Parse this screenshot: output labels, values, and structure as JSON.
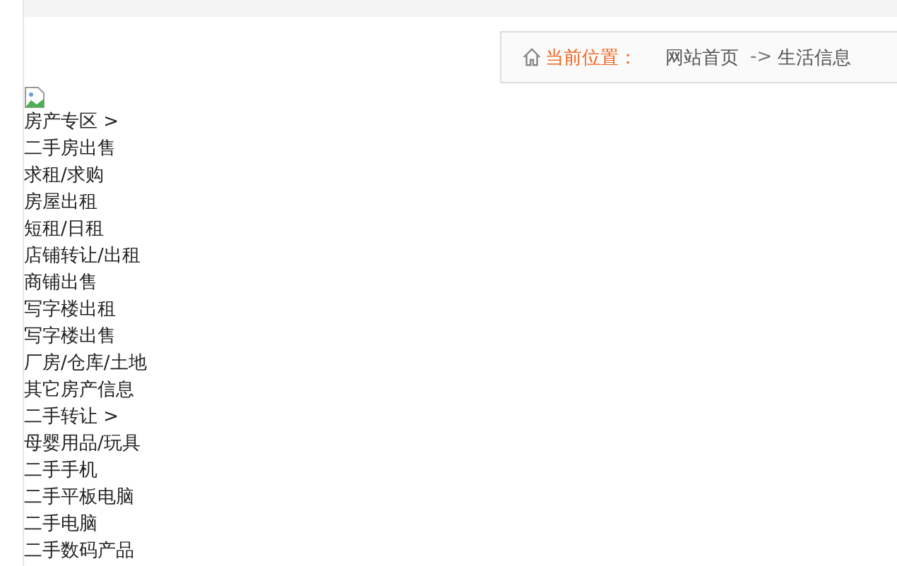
{
  "breadcrumb": {
    "label": "当前位置：",
    "links": [
      {
        "text": "网站首页"
      },
      {
        "text": "生活信息"
      }
    ],
    "separator": "->"
  },
  "menu": [
    {
      "text": "房产专区 >"
    },
    {
      "text": "二手房出售"
    },
    {
      "text": "求租/求购"
    },
    {
      "text": "房屋出租"
    },
    {
      "text": "短租/日租"
    },
    {
      "text": "店铺转让/出租"
    },
    {
      "text": "商铺出售"
    },
    {
      "text": "写字楼出租"
    },
    {
      "text": "写字楼出售"
    },
    {
      "text": "厂房/仓库/土地"
    },
    {
      "text": "其它房产信息"
    },
    {
      "text": "二手转让 >"
    },
    {
      "text": "母婴用品/玩具"
    },
    {
      "text": "二手手机"
    },
    {
      "text": "二手平板电脑"
    },
    {
      "text": "二手电脑"
    },
    {
      "text": "二手数码产品"
    }
  ]
}
